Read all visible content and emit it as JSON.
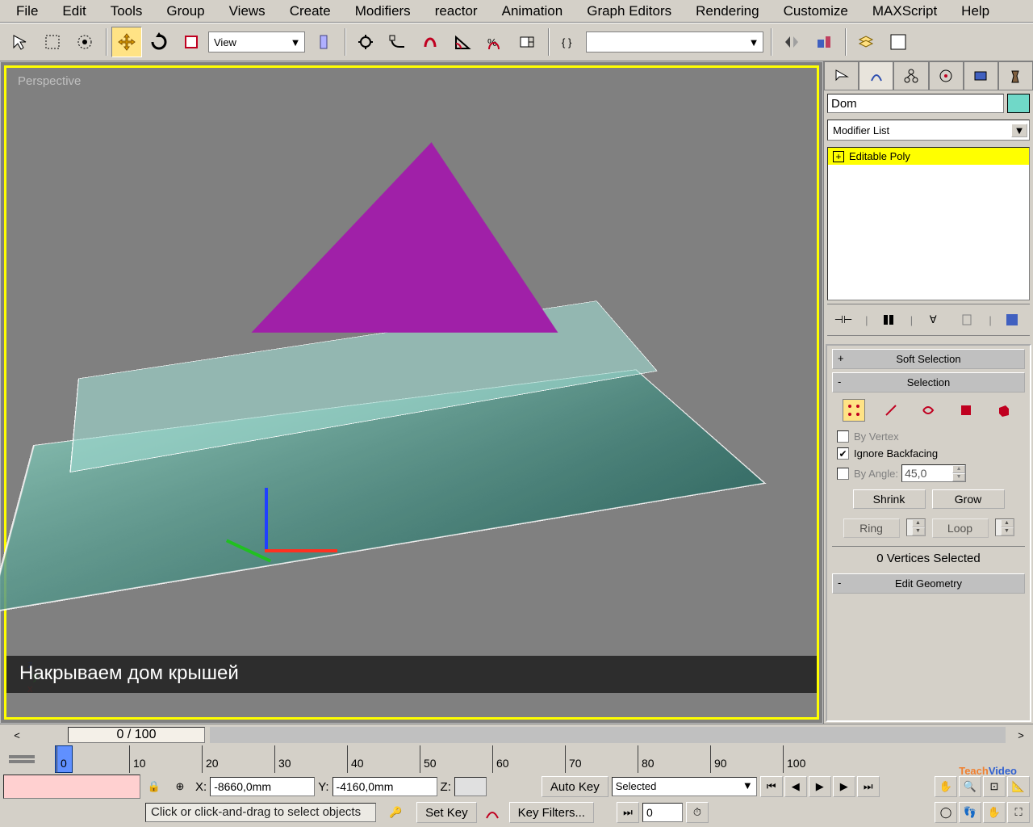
{
  "menu": [
    "File",
    "Edit",
    "Tools",
    "Group",
    "Views",
    "Create",
    "Modifiers",
    "reactor",
    "Animation",
    "Graph Editors",
    "Rendering",
    "Customize",
    "MAXScript",
    "Help"
  ],
  "toolbar": {
    "view_label": "View"
  },
  "viewport": {
    "label": "Perspective",
    "frame_display": "0 / 100",
    "subtitle": "Накрываем дом крышей"
  },
  "panel": {
    "object_name": "Dom",
    "modlist_label": "Modifier List",
    "stack_item": "Editable Poly",
    "rollout_soft": "Soft Selection",
    "rollout_sel": "Selection",
    "by_vertex": "By Vertex",
    "ignore_backfacing": "Ignore Backfacing",
    "by_angle": "By Angle:",
    "angle_value": "45,0",
    "shrink": "Shrink",
    "grow": "Grow",
    "ring": "Ring",
    "loop": "Loop",
    "sel_count": "0 Vertices Selected",
    "rollout_editgeom": "Edit Geometry"
  },
  "ruler": {
    "ticks": [
      "0",
      "10",
      "20",
      "30",
      "40",
      "50",
      "60",
      "70",
      "80",
      "90",
      "100"
    ]
  },
  "coords": {
    "x": "-8660,0mm",
    "y": "-4160,0mm",
    "z": ""
  },
  "keys": {
    "auto": "Auto Key",
    "set": "Set Key",
    "mode_label": "Selected",
    "filters": "Key Filters..."
  },
  "prompt": "Click or click-and-drag to select objects",
  "watermark": {
    "a": "Teach",
    "b": "Video"
  }
}
